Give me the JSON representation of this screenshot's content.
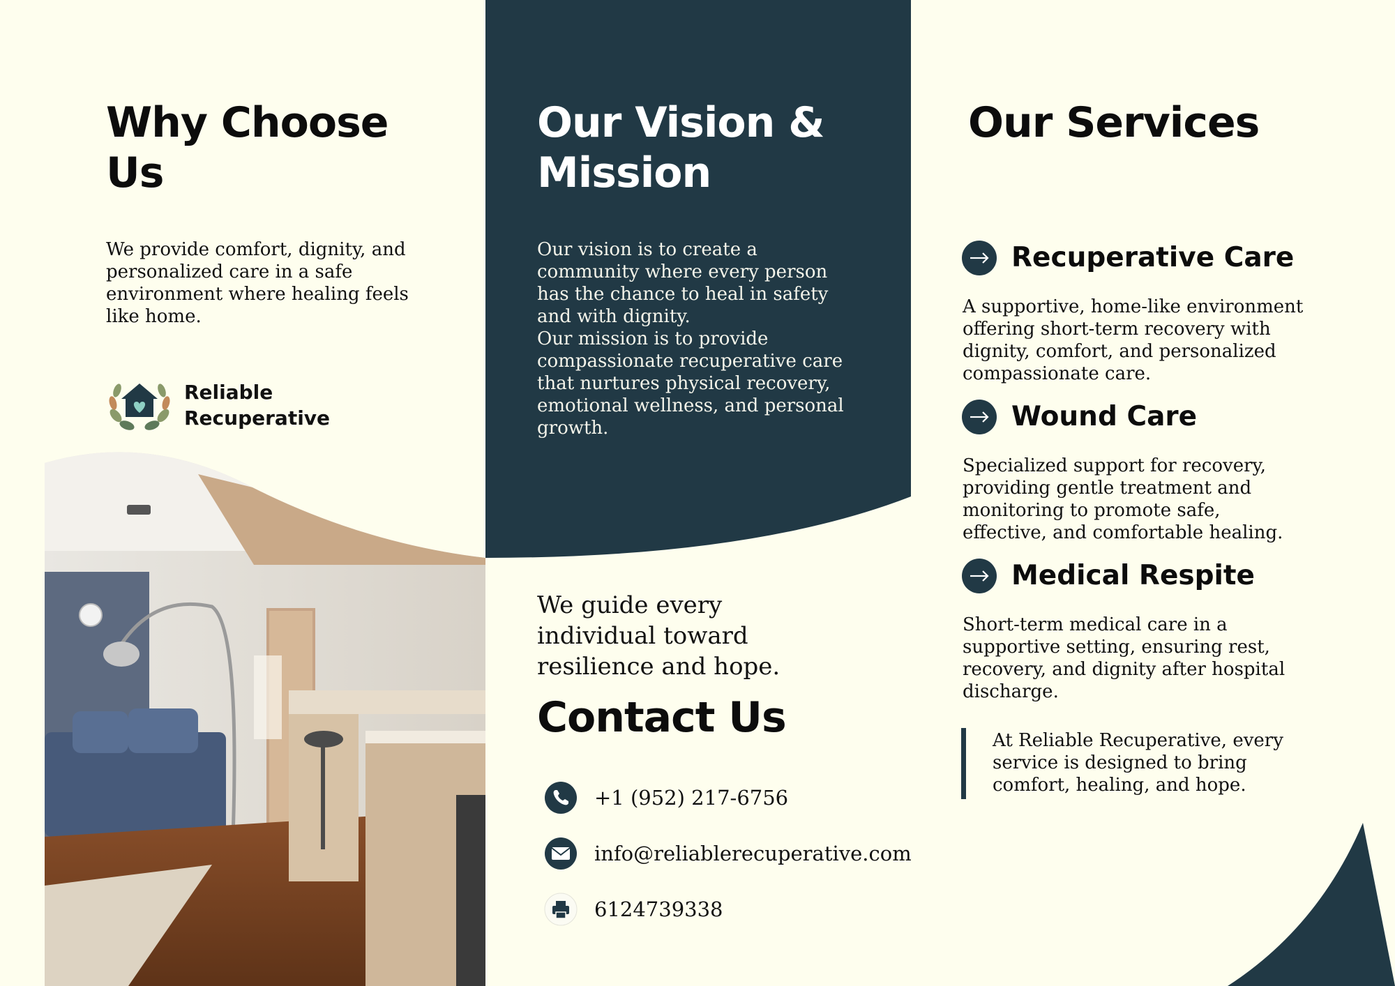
{
  "colors": {
    "cream": "#fefeee",
    "navy": "#213945",
    "text": "#111111"
  },
  "why": {
    "title": "Why Choose Us",
    "body": "We provide comfort, dignity, and personalized care in a safe environment where healing feels like home."
  },
  "logo": {
    "line1": "Reliable",
    "line2": "Recuperative",
    "icon": "house-heart-wreath-icon"
  },
  "vision": {
    "title": "Our Vision & Mission",
    "vision_text": "Our vision is to create a community where every person has the chance to heal in safety and with dignity.",
    "mission_text": "Our mission is to provide compassionate recuperative care that nurtures physical recovery, emotional wellness, and personal growth."
  },
  "guide_text": "We guide every individual toward resilience and hope.",
  "contact": {
    "title": "Contact Us",
    "items": [
      {
        "icon": "phone-icon",
        "text": "+1 (952) 217-6756"
      },
      {
        "icon": "email-icon",
        "text": "info@reliablerecuperative.com"
      },
      {
        "icon": "fax-icon",
        "text": "6124739338"
      }
    ]
  },
  "services": {
    "title": "Our Services",
    "items": [
      {
        "name": "Recuperative Care",
        "desc": "A supportive, home-like environment offering short-term recovery with dignity, comfort, and personalized compassionate care."
      },
      {
        "name": "Wound Care",
        "desc": "Specialized support for recovery, providing gentle treatment and monitoring to promote safe, effective, and comfortable healing."
      },
      {
        "name": "Medical Respite",
        "desc": "Short-term medical care in a supportive setting, ensuring rest, recovery, and dignity after hospital discharge."
      }
    ],
    "quote": "At Reliable Recuperative, every service is designed to bring comfort, healing, and hope."
  }
}
